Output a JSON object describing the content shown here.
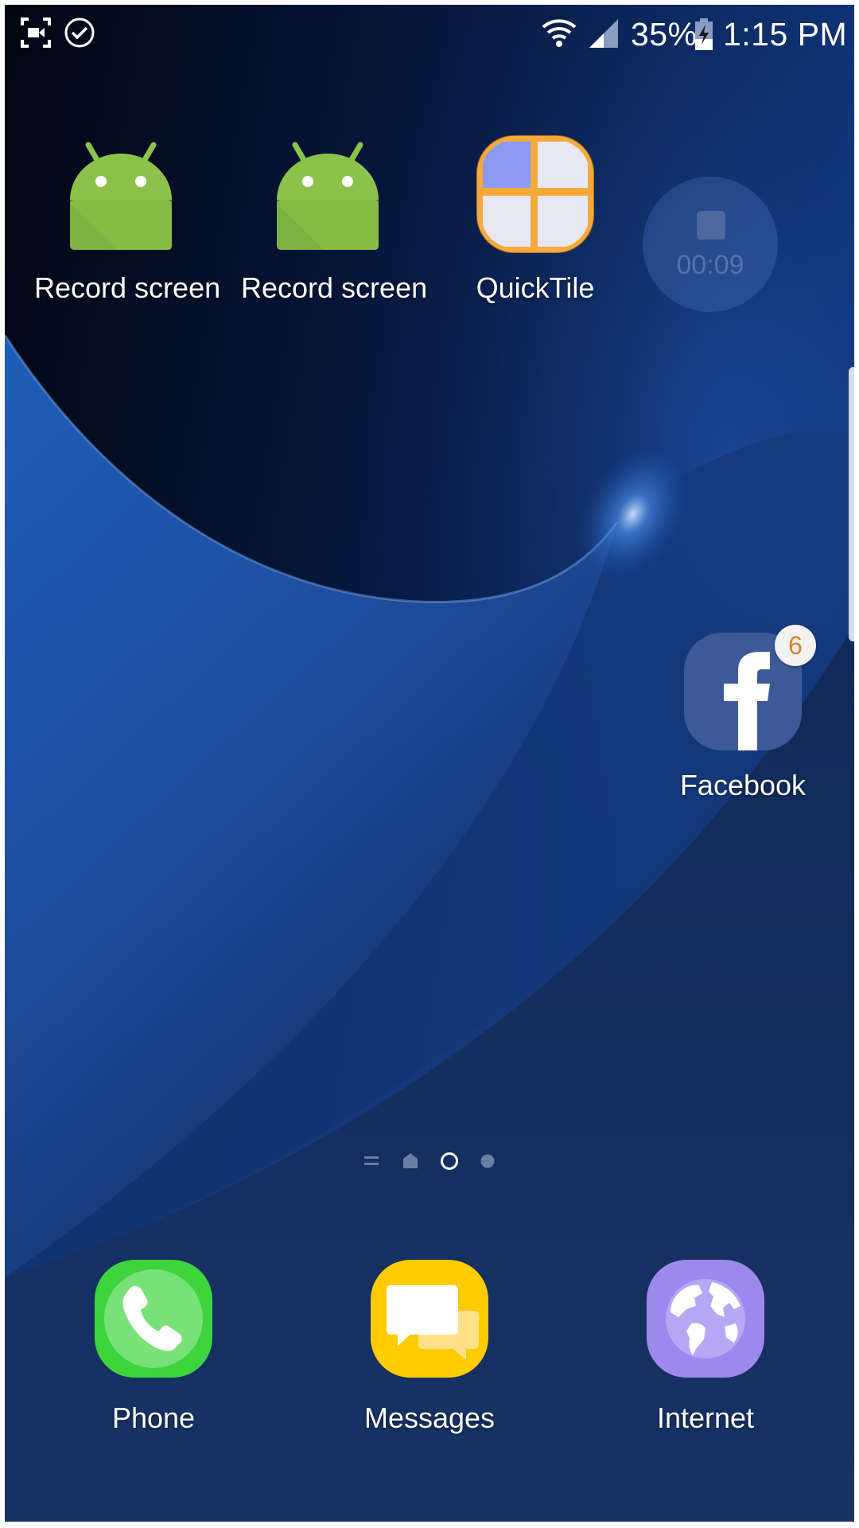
{
  "status_bar": {
    "left_icons": [
      "screen-record-icon",
      "check-circle-icon"
    ],
    "right_icons": [
      "wifi-icon",
      "cellular-signal-icon",
      "battery-charging-icon"
    ],
    "battery_percent": "35%",
    "time": "1:15 PM"
  },
  "home": {
    "apps": [
      {
        "label": "Record screen",
        "icon": "android-icon"
      },
      {
        "label": "Record screen",
        "icon": "android-icon"
      },
      {
        "label": "QuickTile",
        "icon": "quicktile-grid-icon"
      },
      {
        "label": "Facebook",
        "icon": "facebook-icon",
        "badge": "6"
      }
    ],
    "recording_overlay": {
      "icon": "stop-icon",
      "elapsed": "00:09"
    },
    "page_indicator": {
      "items": [
        "menu-lines",
        "home",
        "page",
        "page"
      ],
      "current_index": 2
    }
  },
  "dock": {
    "apps": [
      {
        "label": "Phone",
        "icon": "phone-icon"
      },
      {
        "label": "Messages",
        "icon": "messages-icon"
      },
      {
        "label": "Internet",
        "icon": "globe-icon"
      }
    ]
  },
  "colors": {
    "android_green": "#8bc34a",
    "quicktile_orange": "#f6a93b",
    "facebook_blue": "#3d5a98",
    "phone_green": "#3ed43e",
    "messages_yellow": "#ffcc00",
    "internet_purple": "#9c88ee",
    "badge_text": "#d9822b"
  }
}
